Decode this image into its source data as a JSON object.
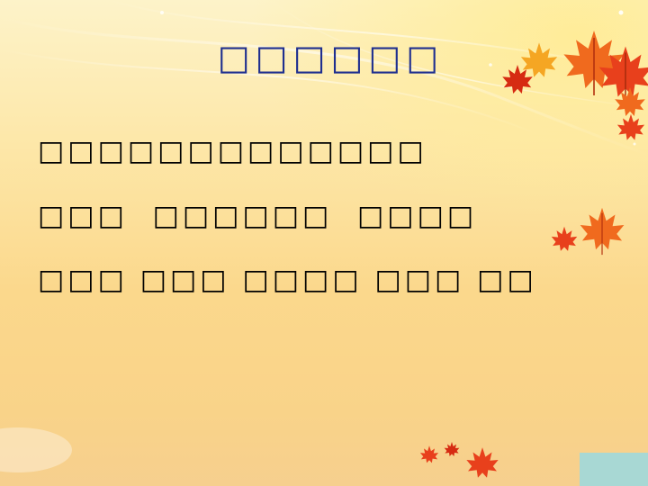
{
  "slide": {
    "title": "□□□□□□",
    "lines": [
      "□□□□□□□□□□□□□",
      "□□□  □□□□□□  □□□□",
      "□□□ □□□ □□□□ □□□ □□"
    ]
  },
  "decorations": {
    "leaf_icon": "maple-leaf-icon",
    "leaf_colors": [
      "#e8401c",
      "#f06a1e",
      "#f5a623",
      "#d62b12"
    ],
    "corner_color": "#a8d8d4"
  }
}
